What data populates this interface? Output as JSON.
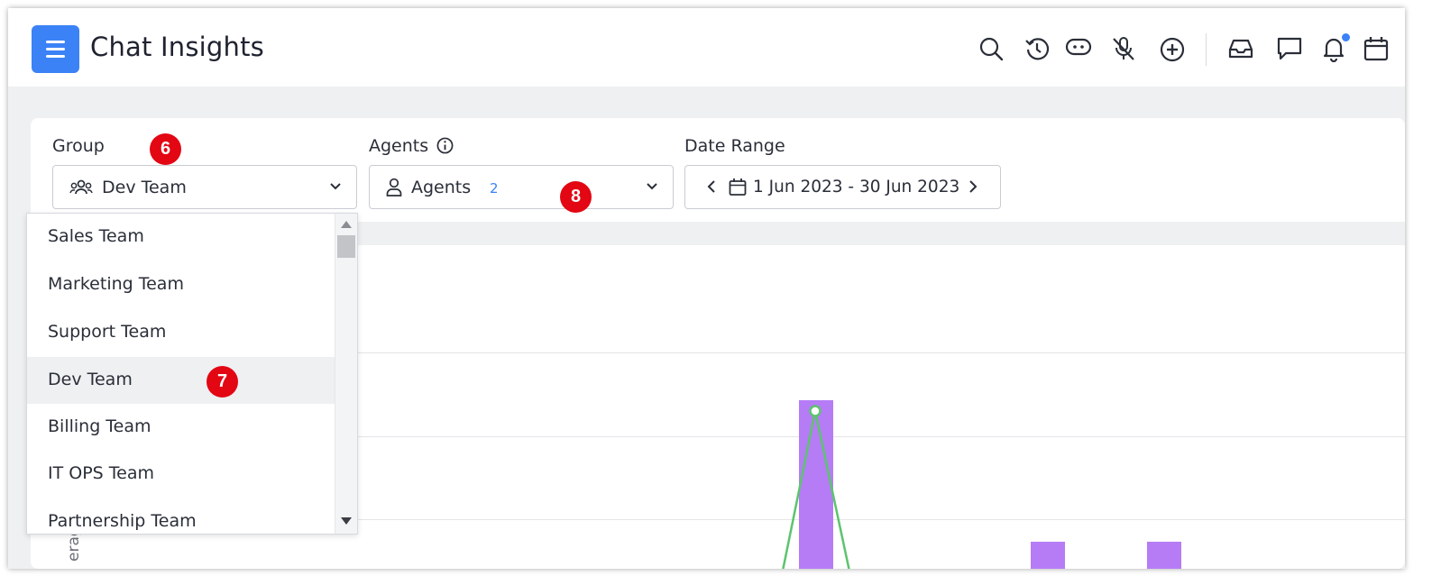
{
  "header": {
    "title": "Chat Insights",
    "icons": [
      "menu-icon",
      "search-icon",
      "history-icon",
      "bot-icon",
      "mic-off-icon",
      "add-circle-icon",
      "inbox-icon",
      "chat-icon",
      "bell-icon",
      "calendar-icon"
    ],
    "accent_color": "#3b82f6"
  },
  "filters": {
    "group": {
      "label": "Group",
      "value": "Dev Team"
    },
    "agents": {
      "label": "Agents",
      "value": "Agents",
      "count": "2"
    },
    "date_range": {
      "label": "Date Range",
      "value": "1 Jun 2023 - 30 Jun 2023"
    }
  },
  "dropdown": {
    "items": [
      "Sales Team",
      "Marketing Team",
      "Support Team",
      "Dev Team",
      "Billing Team",
      "IT OPS Team",
      "Partnership Team"
    ],
    "selected": "Dev Team"
  },
  "annotations": {
    "badge_group": "6",
    "badge_item": "7",
    "badge_agents": "8",
    "badge_color": "#e30613"
  },
  "chart": {
    "y_label_partial": "erage",
    "bar_color": "#b57cf6",
    "line_color": "#5cc46e"
  }
}
